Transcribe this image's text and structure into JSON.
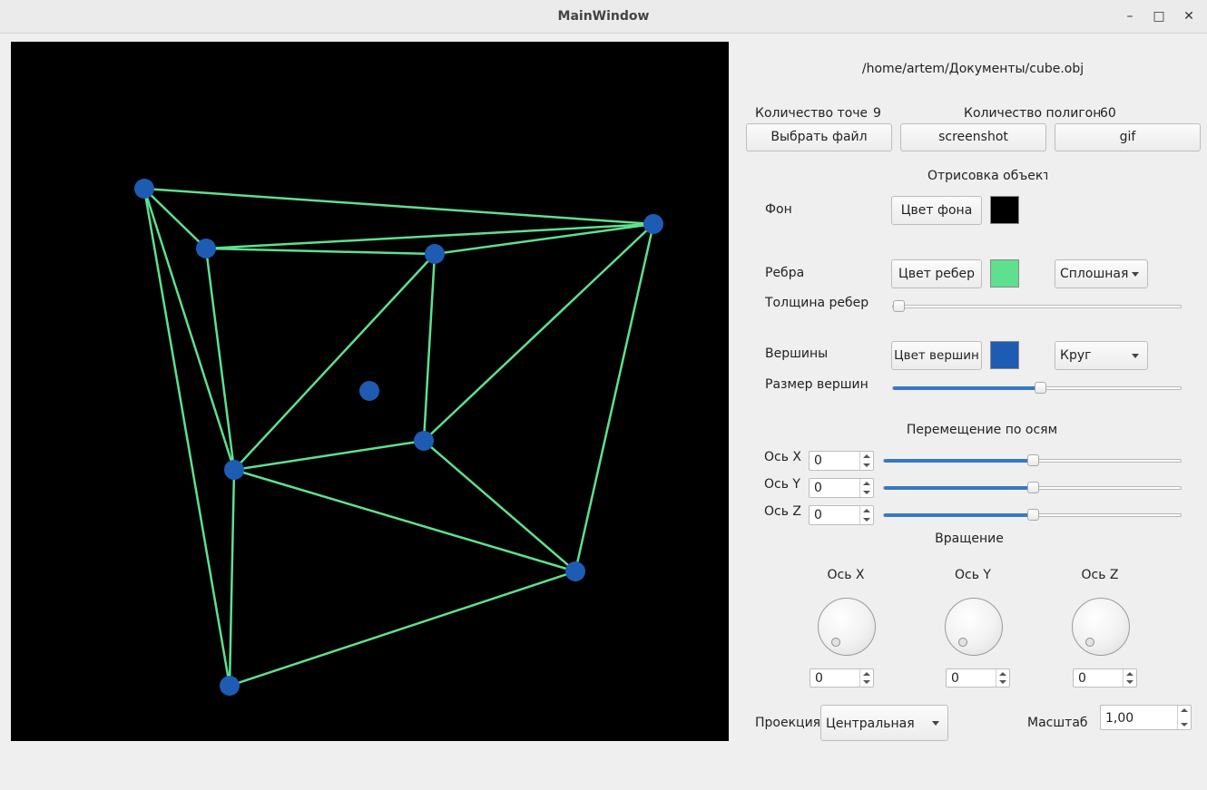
{
  "window": {
    "title": "MainWindow",
    "minimize_glyph": "–",
    "maximize_glyph": "□",
    "close_glyph": "✕"
  },
  "file_path": "/home/artem/Документы/cube.obj",
  "stats": {
    "points_label": "Количество точек",
    "points_value": "9",
    "polygons_label": "Количество полигонов",
    "polygons_value": "60"
  },
  "buttons": {
    "choose_file": "Выбрать файл",
    "screenshot": "screenshot",
    "gif": "gif"
  },
  "render": {
    "section_title": "Отрисовка объекта",
    "background_label": "Фон",
    "background_button": "Цвет фона",
    "background_color": "#000000",
    "edges_label": "Ребра",
    "edges_button": "Цвет ребер",
    "edges_color": "#5ee08f",
    "edges_style": "Сплошная",
    "edge_thickness_label": "Толщина ребер",
    "edge_thickness_value": 0,
    "vertices_label": "Вершины",
    "vertices_button": "Цвет вершин",
    "vertices_color": "#1e5cb3",
    "vertices_shape": "Круг",
    "vertex_size_label": "Размер вершин",
    "vertex_size_value": 0.51
  },
  "move": {
    "section_title": "Перемещение по осям",
    "axes": [
      {
        "label": "Ось X",
        "value": "0",
        "slider": 0.5
      },
      {
        "label": "Ось Y",
        "value": "0",
        "slider": 0.5
      },
      {
        "label": "Ось Z",
        "value": "0",
        "slider": 0.5
      }
    ]
  },
  "rotation": {
    "section_title": "Вращение",
    "axes": [
      {
        "label": "Ось X",
        "value": "0"
      },
      {
        "label": "Ось Y",
        "value": "0"
      },
      {
        "label": "Ось Z",
        "value": "0"
      }
    ]
  },
  "projection": {
    "label": "Проекция",
    "value": "Центральная"
  },
  "scale": {
    "label": "Масштаб",
    "value": "1,00"
  },
  "scene": {
    "edge_color": "#5ee08f",
    "vertex_color": "#1e5cb3"
  }
}
